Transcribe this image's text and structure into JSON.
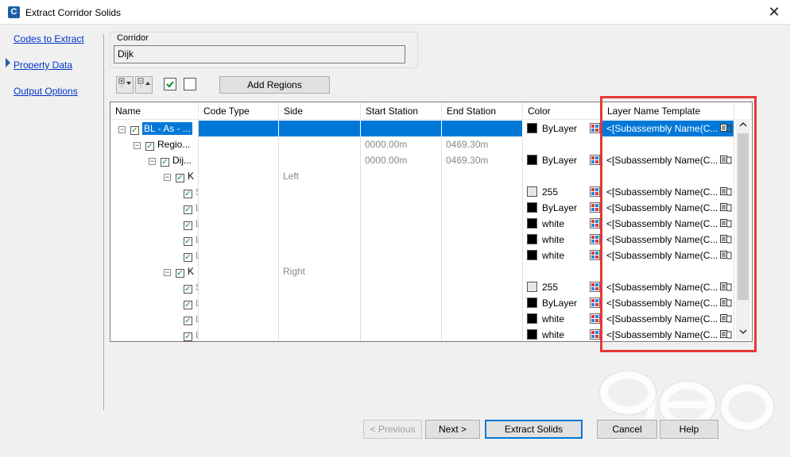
{
  "window": {
    "title": "Extract Corridor Solids",
    "app_icon_letter": "C",
    "close_glyph": "✕"
  },
  "nav": {
    "items": [
      {
        "label": "Codes to Extract",
        "active": true
      },
      {
        "label": "Property Data",
        "active": false
      },
      {
        "label": "Output Options",
        "active": false
      }
    ]
  },
  "corridor": {
    "caption": "Corridor",
    "value": "Dijk"
  },
  "toolbar": {
    "add_regions_label": "Add Regions"
  },
  "grid": {
    "columns": [
      "Name",
      "Code Type",
      "Side",
      "Start Station",
      "End Station",
      "Color",
      "Layer Name Template"
    ],
    "rows": [
      {
        "name": "BL - As - ...",
        "code_type": "",
        "side": "",
        "start": "",
        "end": "",
        "color": "ByLayer",
        "swatch": "#000000",
        "layer": "<[Subassembly Name(C...",
        "selected": true
      },
      {
        "name": "Regio...",
        "code_type": "",
        "side": "",
        "start": "0000.00m",
        "end": "0469.30m",
        "color": "",
        "swatch": "",
        "layer": "",
        "selected": false
      },
      {
        "name": "Dij...",
        "code_type": "",
        "side": "",
        "start": "0000.00m",
        "end": "0469.30m",
        "color": "ByLayer",
        "swatch": "#000000",
        "layer": "<[Subassembly Name(C...",
        "selected": false
      },
      {
        "name": "K",
        "code_type": "",
        "side": "Left",
        "start": "",
        "end": "",
        "color": "",
        "swatch": "",
        "layer": "",
        "selected": false
      },
      {
        "name": "Shape",
        "code_type": "",
        "side": "",
        "start": "",
        "end": "",
        "color": "255",
        "swatch": "#e6e6e6",
        "layer": "<[Subassembly Name(C...",
        "selected": false
      },
      {
        "name": "Link",
        "code_type": "",
        "side": "",
        "start": "",
        "end": "",
        "color": "ByLayer",
        "swatch": "#000000",
        "layer": "<[Subassembly Name(C...",
        "selected": false
      },
      {
        "name": "Link",
        "code_type": "",
        "side": "",
        "start": "",
        "end": "",
        "color": "white",
        "swatch": "#000000",
        "layer": "<[Subassembly Name(C...",
        "selected": false
      },
      {
        "name": "Link",
        "code_type": "",
        "side": "",
        "start": "",
        "end": "",
        "color": "white",
        "swatch": "#000000",
        "layer": "<[Subassembly Name(C...",
        "selected": false
      },
      {
        "name": "Link",
        "code_type": "",
        "side": "",
        "start": "",
        "end": "",
        "color": "white",
        "swatch": "#000000",
        "layer": "<[Subassembly Name(C...",
        "selected": false
      },
      {
        "name": "K",
        "code_type": "",
        "side": "Right",
        "start": "",
        "end": "",
        "color": "",
        "swatch": "",
        "layer": "",
        "selected": false
      },
      {
        "name": "Shape",
        "code_type": "",
        "side": "",
        "start": "",
        "end": "",
        "color": "255",
        "swatch": "#e6e6e6",
        "layer": "<[Subassembly Name(C...",
        "selected": false
      },
      {
        "name": "Link",
        "code_type": "",
        "side": "",
        "start": "",
        "end": "",
        "color": "ByLayer",
        "swatch": "#000000",
        "layer": "<[Subassembly Name(C...",
        "selected": false
      },
      {
        "name": "Link",
        "code_type": "",
        "side": "",
        "start": "",
        "end": "",
        "color": "white",
        "swatch": "#000000",
        "layer": "<[Subassembly Name(C...",
        "selected": false
      },
      {
        "name": "Link",
        "code_type": "",
        "side": "",
        "start": "",
        "end": "",
        "color": "white",
        "swatch": "#000000",
        "layer": "<[Subassembly Name(C...",
        "selected": false
      }
    ]
  },
  "footer": {
    "previous_label": "< Previous",
    "next_label": "Next >",
    "extract_label": "Extract Solids",
    "cancel_label": "Cancel",
    "help_label": "Help"
  },
  "colors": {
    "accent": "#0078d7",
    "highlight_box": "#e53935",
    "link": "#0033cc"
  }
}
